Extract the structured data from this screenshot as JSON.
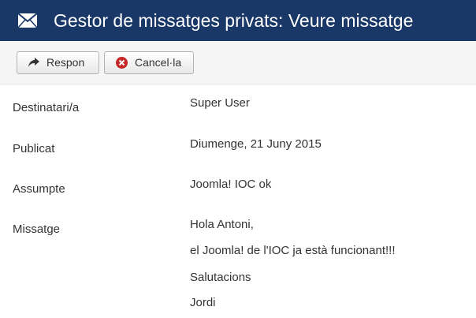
{
  "header": {
    "title": "Gestor de missatges privats: Veure missatge",
    "icon": "envelope-icon",
    "background": "#1a3867"
  },
  "toolbar": {
    "reply_label": "Respon",
    "reply_icon": "reply-arrow-icon",
    "cancel_label": "Cancel·la",
    "cancel_icon": "cancel-circle-icon",
    "cancel_icon_color": "#c52827"
  },
  "message": {
    "fields": [
      {
        "label": "Destinatari/a",
        "value": "Super User"
      },
      {
        "label": "Publicat",
        "value": "Diumenge, 21 Juny 2015"
      },
      {
        "label": "Assumpte",
        "value": "Joomla! IOC ok"
      }
    ],
    "body_label": "Missatge",
    "body_lines": [
      "Hola Antoni,",
      "el Joomla! de l'IOC ja està funcionant!!!",
      "Salutacions",
      "Jordi"
    ]
  }
}
